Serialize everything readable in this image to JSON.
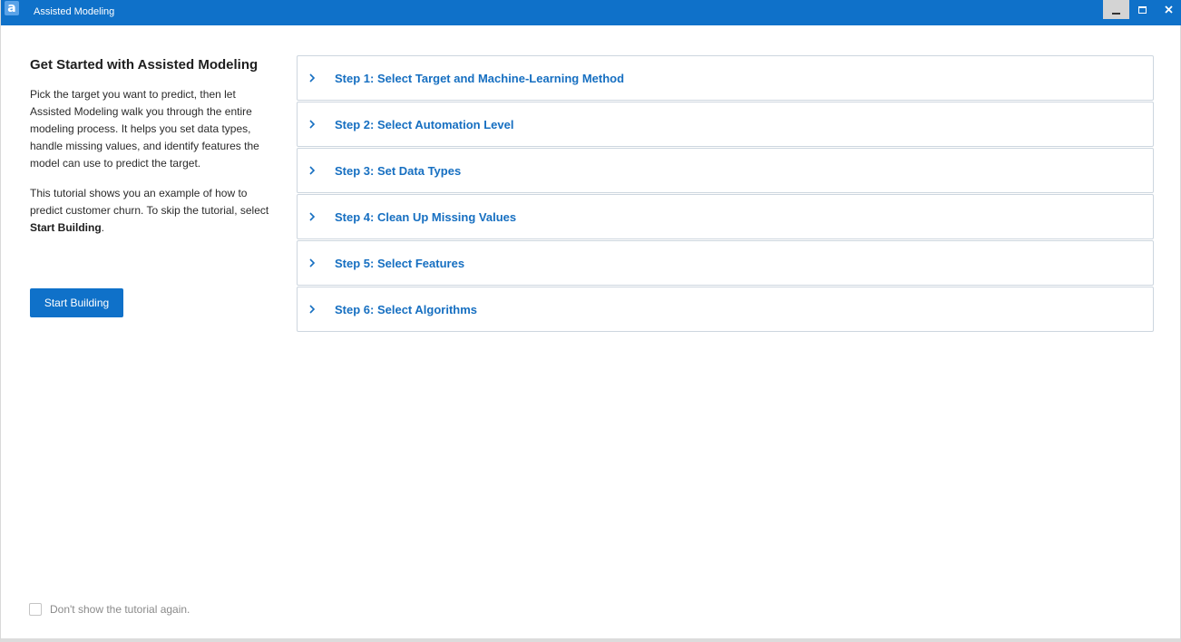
{
  "window": {
    "app_icon_glyph": "a",
    "title": "Assisted Modeling",
    "controls": [
      "minimize",
      "maximize",
      "close"
    ]
  },
  "intro": {
    "heading": "Get Started with Assisted Modeling",
    "paragraph1": "Pick the target you want to predict, then let Assisted Modeling walk you through the entire modeling process. It helps you set data types, handle missing values, and identify features the model can use to predict the target.",
    "paragraph2_prefix": "This tutorial shows you an example of how to predict customer churn. To skip the tutorial, select ",
    "paragraph2_bold": "Start Building",
    "paragraph2_suffix": ".",
    "start_button_label": "Start Building"
  },
  "steps": [
    {
      "label": "Step 1: Select Target and Machine-Learning Method"
    },
    {
      "label": "Step 2: Select Automation Level"
    },
    {
      "label": "Step 3: Set Data Types"
    },
    {
      "label": "Step 4: Clean Up Missing Values"
    },
    {
      "label": "Step 5: Select Features"
    },
    {
      "label": "Step 6: Select Algorithms"
    }
  ],
  "footer": {
    "checkbox_label": "Don't show the tutorial again.",
    "checked": false
  },
  "colors": {
    "titlebar": "#0f71c9",
    "accent": "#166fc1",
    "button": "#0f71c9"
  }
}
